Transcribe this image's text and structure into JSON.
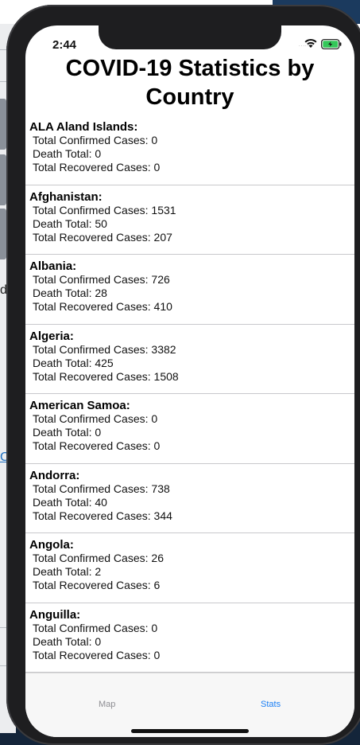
{
  "status_bar": {
    "time": "2:44",
    "signal_dots": "....."
  },
  "title": "COVID-19 Statistics by Country",
  "labels": {
    "confirmed": "Total Confirmed Cases:",
    "deaths": "Death Total:",
    "recovered": "Total Recovered Cases:"
  },
  "countries": [
    {
      "name": "ALA Aland Islands:",
      "confirmed": "0",
      "deaths": "0",
      "recovered": "0"
    },
    {
      "name": "Afghanistan:",
      "confirmed": "1531",
      "deaths": "50",
      "recovered": "207"
    },
    {
      "name": "Albania:",
      "confirmed": "726",
      "deaths": "28",
      "recovered": "410"
    },
    {
      "name": "Algeria:",
      "confirmed": "3382",
      "deaths": "425",
      "recovered": "1508"
    },
    {
      "name": "American Samoa:",
      "confirmed": "0",
      "deaths": "0",
      "recovered": "0"
    },
    {
      "name": "Andorra:",
      "confirmed": "738",
      "deaths": "40",
      "recovered": "344"
    },
    {
      "name": "Angola:",
      "confirmed": "26",
      "deaths": "2",
      "recovered": "6"
    },
    {
      "name": "Anguilla:",
      "confirmed": "0",
      "deaths": "0",
      "recovered": "0"
    }
  ],
  "tabs": [
    {
      "label": "Map",
      "active": false
    },
    {
      "label": "Stats",
      "active": true
    }
  ],
  "colors": {
    "active_tab": "#1a7ff5",
    "inactive_tab": "#8e8e93",
    "battery": "#34c759"
  },
  "background": {
    "letter_left_1": "d",
    "letter_left_2": "C"
  }
}
